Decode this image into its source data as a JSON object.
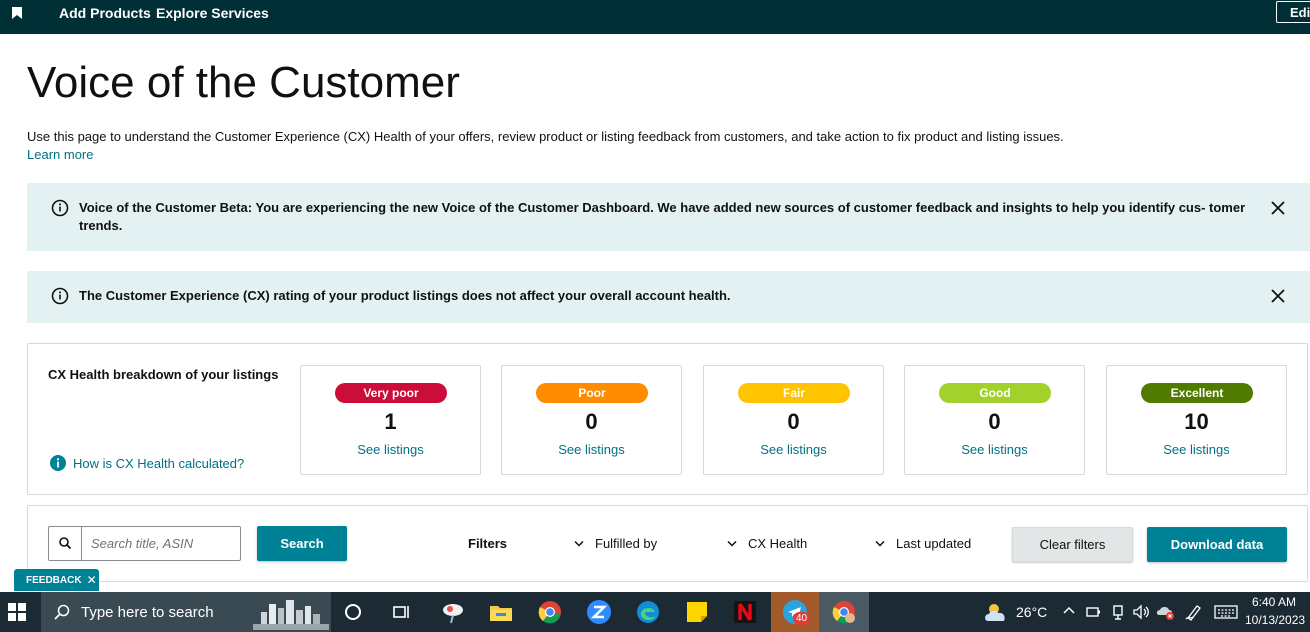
{
  "topnav": {
    "links": [
      "Add Products",
      "Explore Services"
    ],
    "edit_label": "Edit"
  },
  "page": {
    "title": "Voice of the Customer",
    "description": "Use this page to understand the Customer Experience (CX) Health of your offers, review product or listing feedback from customers, and take action to fix product and listing issues.",
    "learn_more": "Learn more"
  },
  "alerts": [
    {
      "text": "Voice of the Customer Beta: You are experiencing the new Voice of the Customer Dashboard. We have added new sources of customer feedback and insights to help you identify cus- tomer trends."
    },
    {
      "text": "The Customer Experience (CX) rating of your product listings does not affect your overall account health."
    }
  ],
  "cx_health": {
    "title": "CX Health breakdown of your listings",
    "help_link": "How is CX Health calculated?",
    "cards": [
      {
        "label": "Very poor",
        "count": "1",
        "link": "See listings",
        "color": "#cc0c39",
        "text_color": "#ffffff"
      },
      {
        "label": "Poor",
        "count": "0",
        "link": "See listings",
        "color": "#ff8c00",
        "text_color": "#ffffff"
      },
      {
        "label": "Fair",
        "count": "0",
        "link": "See listings",
        "color": "#ffc400",
        "text_color": "#ffffff"
      },
      {
        "label": "Good",
        "count": "0",
        "link": "See listings",
        "color": "#a3d12c",
        "text_color": "#ffffff"
      },
      {
        "label": "Excellent",
        "count": "10",
        "link": "See listings",
        "color": "#507b00",
        "text_color": "#ffffff"
      }
    ]
  },
  "filters": {
    "search_placeholder": "Search title, ASIN",
    "search_button": "Search",
    "label": "Filters",
    "dropdowns": [
      "Fulfilled by",
      "CX Health",
      "Last updated"
    ],
    "clear_button": "Clear filters",
    "download_button": "Download data"
  },
  "feedback": {
    "label": "FEEDBACK",
    "close": "✕"
  },
  "taskbar": {
    "search_placeholder": "Type here to search",
    "telegram_badge": "40",
    "temperature": "26°C",
    "time": "6:40 AM",
    "date": "10/13/2023"
  },
  "colors": {
    "nav_bg": "#002f36",
    "alert_bg": "#e3f1f2",
    "link": "#007185",
    "button_primary": "#008296"
  }
}
